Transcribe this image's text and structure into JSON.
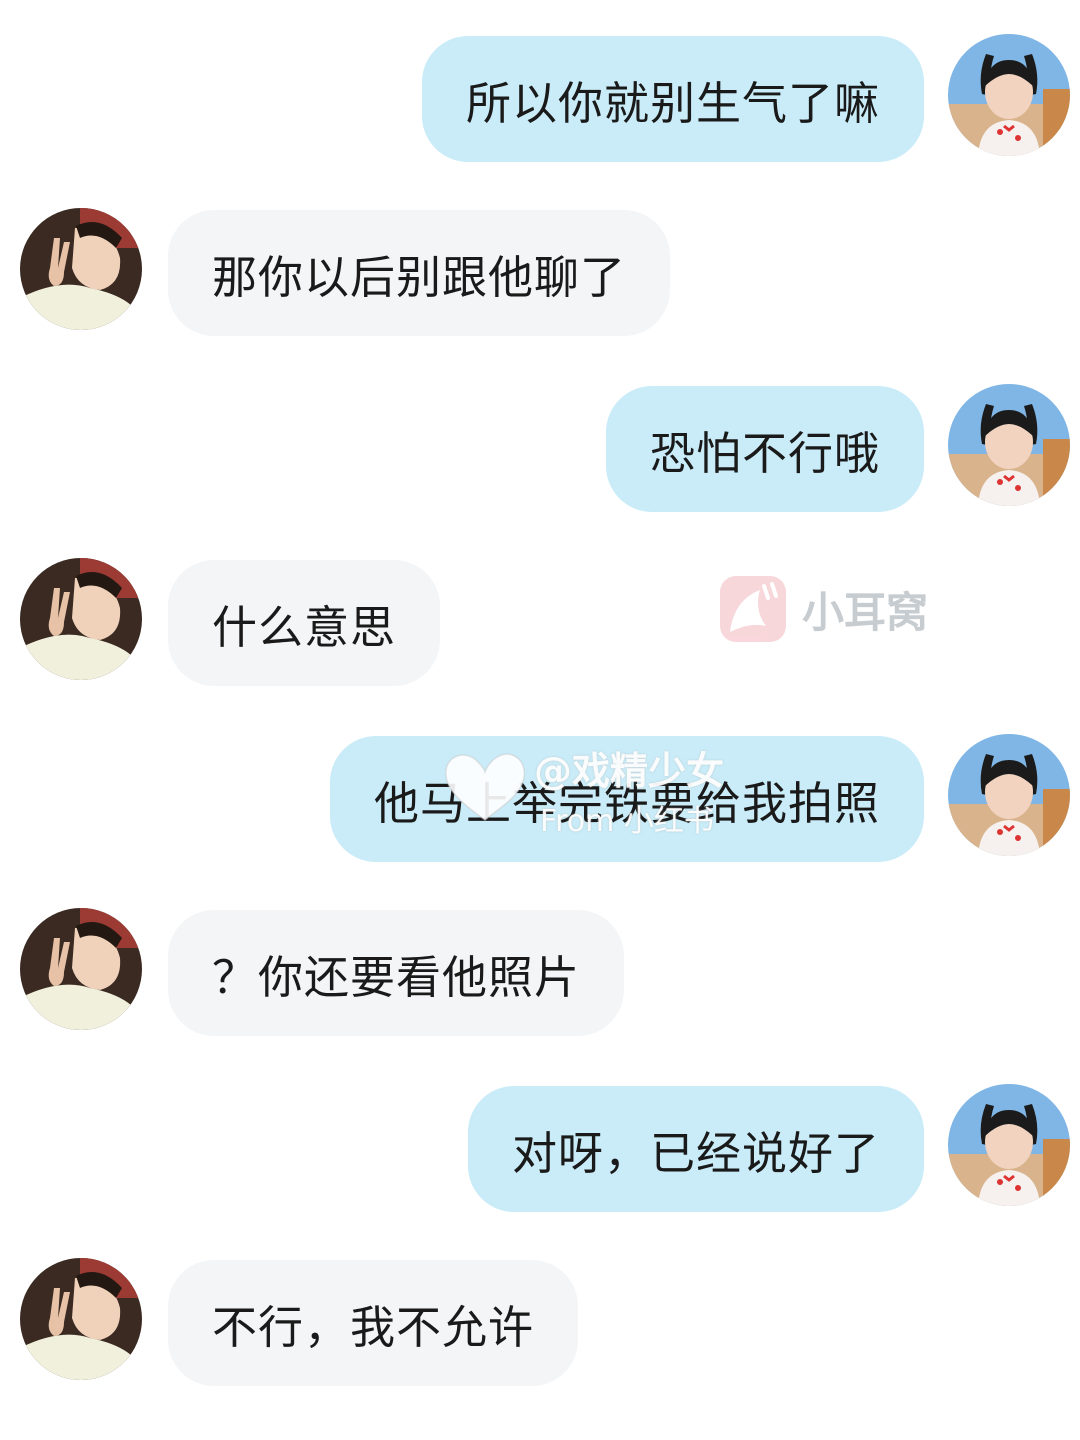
{
  "messages": [
    {
      "side": "me",
      "text": "所以你就别生气了嘛"
    },
    {
      "side": "other",
      "text": "那你以后别跟他聊了"
    },
    {
      "side": "me",
      "text": "恐怕不行哦"
    },
    {
      "side": "other",
      "text": "什么意思"
    },
    {
      "side": "me",
      "text": "他马上举完铁要给我拍照"
    },
    {
      "side": "other",
      "text": "？你还要看他照片"
    },
    {
      "side": "me",
      "text": "对呀，已经说好了"
    },
    {
      "side": "other",
      "text": "不行，我不允许"
    }
  ],
  "watermarks": {
    "app_name": "小耳窝",
    "handle": "@戏精少女",
    "from": "From 小红书"
  },
  "colors": {
    "me_bubble": "#c9ecf8",
    "other_bubble": "#f3f5f7",
    "background": "#ffffff"
  },
  "icons": {
    "me_avatar": "avatar-girl-pigtails",
    "other_avatar": "avatar-boy-peace-sign",
    "app_logo": "xiaoerwo-logo-icon",
    "heart": "heart-icon"
  }
}
